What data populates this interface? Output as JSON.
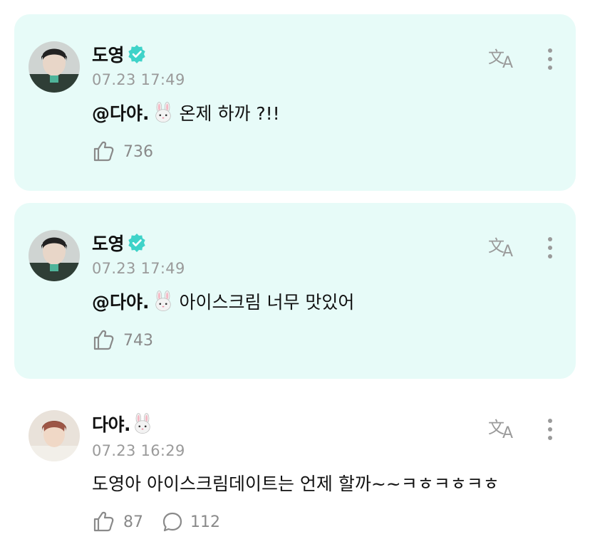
{
  "colors": {
    "card_bg": "#e7fbf8",
    "verified": "#3fd3c9",
    "muted": "#9a9a9a"
  },
  "posts": [
    {
      "author": "도영",
      "verified": true,
      "timestamp": "07.23 17:49",
      "mention": "@다야.",
      "text": "온제 하까 ?!!",
      "likes": "736",
      "highlighted": true
    },
    {
      "author": "도영",
      "verified": true,
      "timestamp": "07.23 17:49",
      "mention": "@다야.",
      "text": "아이스크림 너무 맛있어",
      "likes": "743",
      "highlighted": true
    },
    {
      "author": "다야.",
      "verified": false,
      "timestamp": "07.23 16:29",
      "text": "도영아 아이스크림데이트는 언제 할까~~ㅋㅎㅋㅎㅋㅎ",
      "likes": "87",
      "comments": "112",
      "highlighted": false
    }
  ],
  "icons": {
    "verified": "verified-badge-icon",
    "bunny": "rabbit-face-icon",
    "translate": "translate-icon",
    "more": "more-vertical-icon",
    "like": "like-icon",
    "comment": "comment-bubble-icon"
  }
}
